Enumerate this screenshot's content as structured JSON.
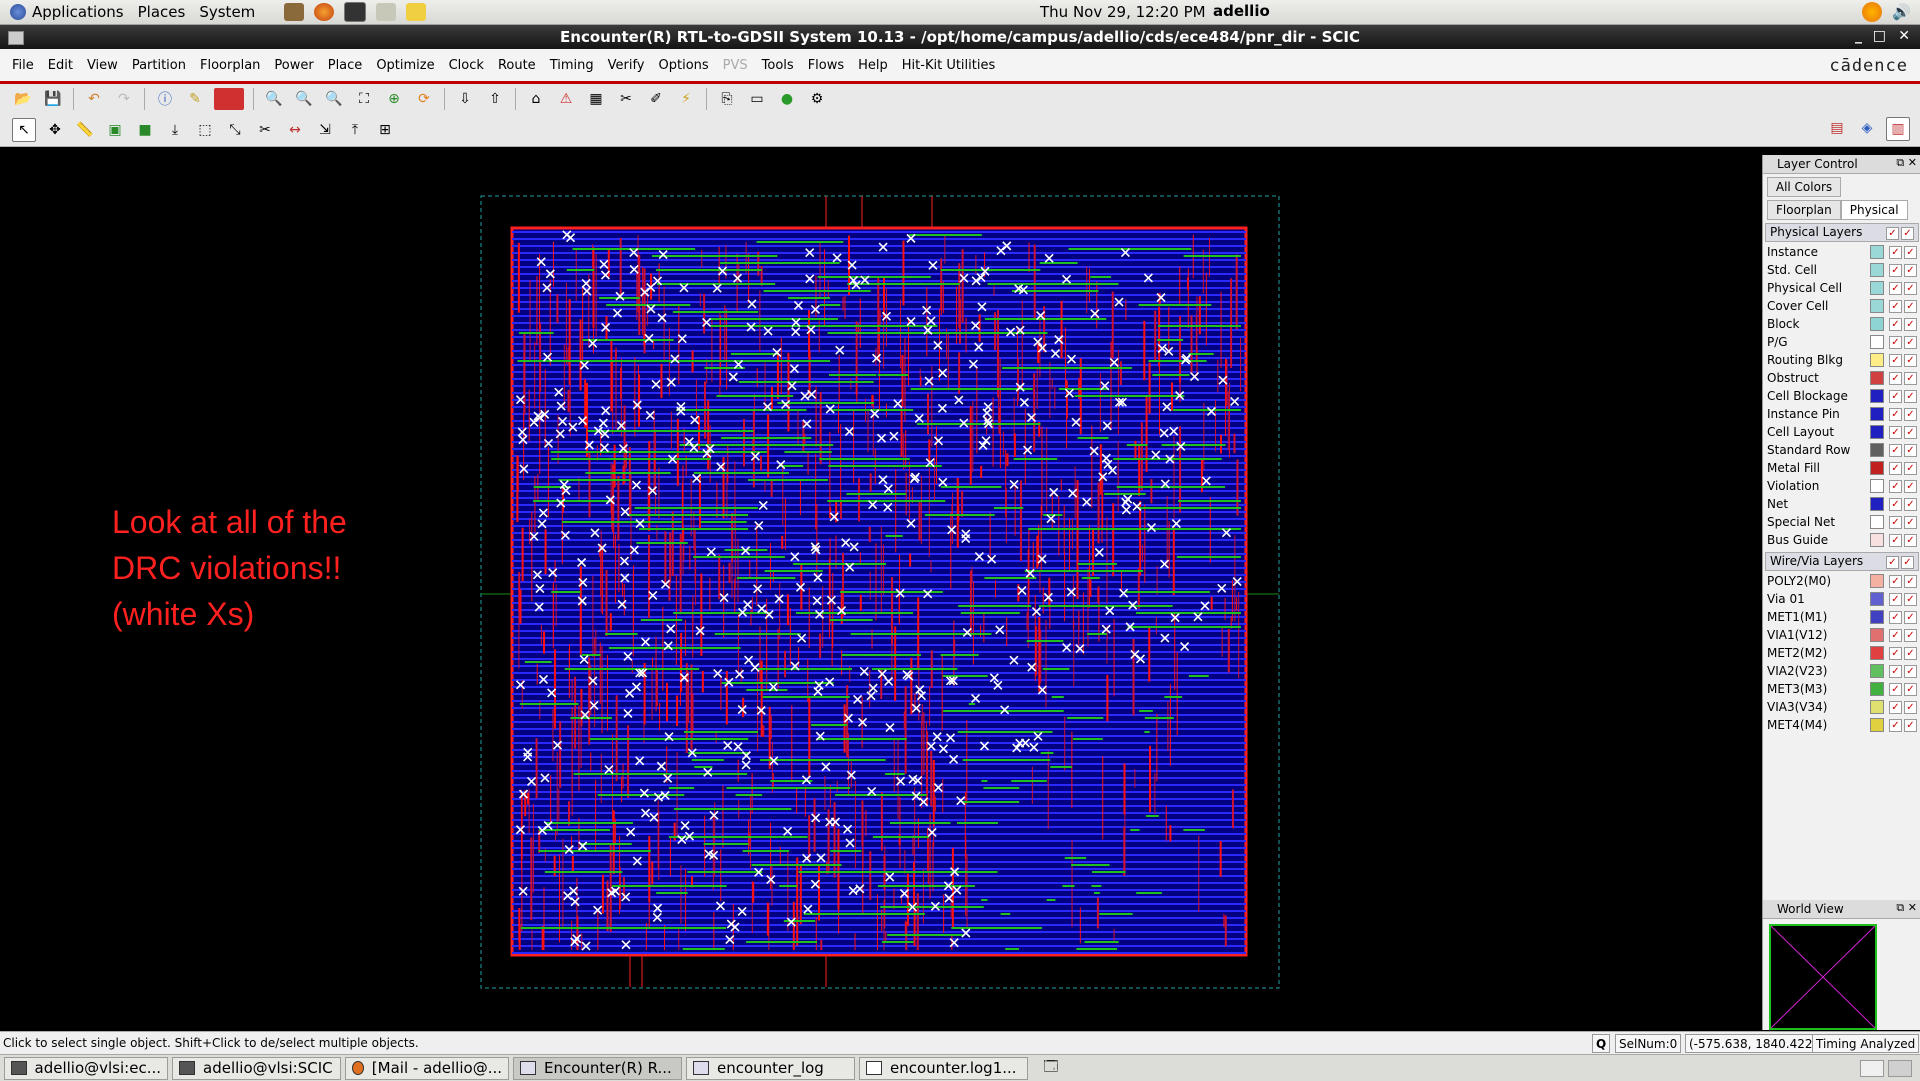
{
  "top_panel": {
    "menus": [
      "Applications",
      "Places",
      "System"
    ],
    "clock": "Thu Nov 29, 12:20 PM",
    "user": "adellio"
  },
  "window": {
    "title": "Encounter(R) RTL-to-GDSII System 10.13 - /opt/home/campus/adellio/cds/ece484/pnr_dir - SCIC",
    "controls": [
      "_",
      "□",
      "✕"
    ]
  },
  "menubar": {
    "items": [
      "File",
      "Edit",
      "View",
      "Partition",
      "Floorplan",
      "Power",
      "Place",
      "Optimize",
      "Clock",
      "Route",
      "Timing",
      "Verify",
      "Options",
      "PVS",
      "Tools",
      "Flows",
      "Help",
      "Hit-Kit Utilities"
    ],
    "brand": "cādence"
  },
  "canvas": {
    "annotation": "Look at all of the\nDRC violations!!\n(white Xs)"
  },
  "layer_control": {
    "title": "Layer Control",
    "all_colors": "All Colors",
    "tabs": [
      "Floorplan",
      "Physical"
    ],
    "active_tab": "Physical",
    "physical_header": "Physical Layers",
    "physical_layers": [
      {
        "name": "Instance",
        "color": "#9ad8d8"
      },
      {
        "name": "Std. Cell",
        "color": "#9ad8d8"
      },
      {
        "name": "Physical Cell",
        "color": "#9ad8d8"
      },
      {
        "name": "Cover Cell",
        "color": "#9ad8d8"
      },
      {
        "name": "Block",
        "color": "#8fd4d4"
      },
      {
        "name": "P/G",
        "color": "#ffffff"
      },
      {
        "name": "Routing Blkg",
        "color": "#ffee88"
      },
      {
        "name": "Obstruct",
        "color": "#d04040"
      },
      {
        "name": "Cell Blockage",
        "color": "#2020c0"
      },
      {
        "name": "Instance Pin",
        "color": "#2020c0"
      },
      {
        "name": "Cell Layout",
        "color": "#2020c0"
      },
      {
        "name": "Standard Row",
        "color": "#606060"
      },
      {
        "name": "Metal Fill",
        "color": "#c02020"
      },
      {
        "name": "Violation",
        "color": "#ffffff"
      },
      {
        "name": "Net",
        "color": "#2020c0"
      },
      {
        "name": "Special Net",
        "color": "#ffffff"
      },
      {
        "name": "Bus Guide",
        "color": "#f8e0e0"
      }
    ],
    "wire_header": "Wire/Via Layers",
    "wire_layers": [
      {
        "name": "POLY2(M0)",
        "color": "#f4b0a0"
      },
      {
        "name": "Via 01",
        "color": "#6060d0"
      },
      {
        "name": "MET1(M1)",
        "color": "#4040c0"
      },
      {
        "name": "VIA1(V12)",
        "color": "#e07070"
      },
      {
        "name": "MET2(M2)",
        "color": "#e04040"
      },
      {
        "name": "VIA2(V23)",
        "color": "#60c060"
      },
      {
        "name": "MET3(M3)",
        "color": "#40b040"
      },
      {
        "name": "VIA3(V34)",
        "color": "#e0e070"
      },
      {
        "name": "MET4(M4)",
        "color": "#e0d040"
      }
    ]
  },
  "world_view": {
    "title": "World View"
  },
  "statusbar": {
    "message": "Click to select single object. Shift+Click to de/select multiple objects.",
    "q_button": "Q",
    "selnum": "SelNum:0",
    "coords": "(-575.638, 1840.422)",
    "timing": "Timing Analyzed"
  },
  "taskbar": {
    "tasks": [
      "adellio@vlsi:ec...",
      "adellio@vlsi:SCIC",
      "[Mail - adellio@...",
      "Encounter(R) R...",
      "encounter_log",
      "encounter.log1..."
    ]
  }
}
